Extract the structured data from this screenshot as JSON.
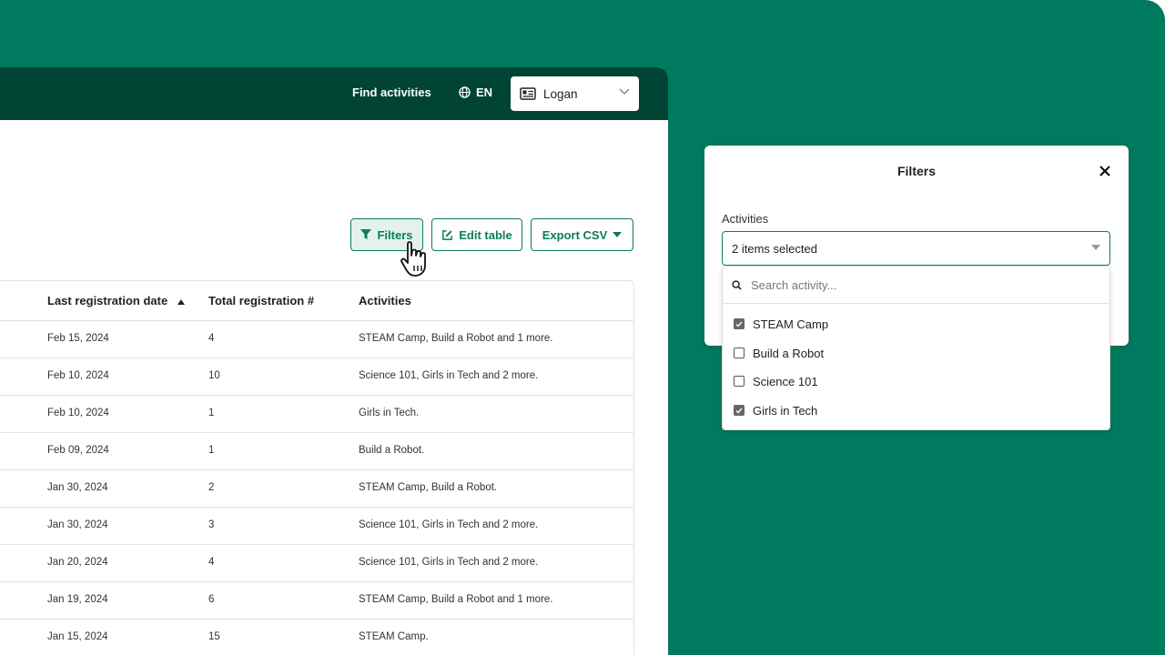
{
  "topbar": {
    "find_activities": "Find activities",
    "language": "EN",
    "user": "Logan"
  },
  "toolbar": {
    "filters": "Filters",
    "edit_table": "Edit table",
    "export_csv": "Export CSV"
  },
  "table": {
    "columns": [
      "Last registration date",
      "Total registration #",
      "Activities"
    ],
    "sort_column": "Last registration date",
    "sort_direction": "ascending",
    "rows": [
      [
        "Feb 15, 2024",
        "4",
        "STEAM Camp, Build a Robot and 1 more."
      ],
      [
        "Feb 10, 2024",
        "10",
        "Science 101, Girls in Tech and 2 more."
      ],
      [
        "Feb 10, 2024",
        "1",
        "Girls in Tech."
      ],
      [
        "Feb 09, 2024",
        "1",
        "Build a Robot."
      ],
      [
        "Jan 30, 2024",
        "2",
        "STEAM Camp, Build a Robot."
      ],
      [
        "Jan 30, 2024",
        "3",
        "Science 101, Girls in Tech and 2 more."
      ],
      [
        "Jan 20, 2024",
        "4",
        "Science 101, Girls in Tech and 2 more."
      ],
      [
        "Jan 19, 2024",
        "6",
        "STEAM Camp, Build a Robot and 1 more."
      ],
      [
        "Jan 15, 2024",
        "15",
        "STEAM Camp."
      ]
    ]
  },
  "filters_panel": {
    "title": "Filters",
    "activities_label": "Activities",
    "selected_text": "2 items selected",
    "search_placeholder": "Search activity...",
    "options": [
      {
        "label": "STEAM Camp",
        "checked": true
      },
      {
        "label": "Build a Robot",
        "checked": false
      },
      {
        "label": "Science 101",
        "checked": false
      },
      {
        "label": "Girls in Tech",
        "checked": true
      }
    ]
  },
  "colors": {
    "background": "#007a5e",
    "topbar": "#004433",
    "accent": "#0b7d5c"
  }
}
